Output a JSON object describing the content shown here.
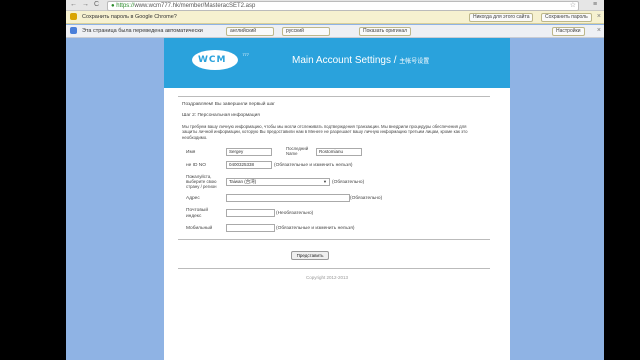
{
  "browser": {
    "url": {
      "scheme": "https://",
      "rest": "www.wcm777.hk/member/MasteracSET2.asp"
    },
    "nav_back": "←",
    "nav_forward": "→",
    "nav_reload": "C",
    "menu": "≡"
  },
  "password_bar": {
    "message": "Сохранить пароль в Google Chrome?",
    "save_label": "Сохранить пароль",
    "never_label": "Никогда для этого сайта"
  },
  "translate_bar": {
    "message": "Эта страница была переведена автоматически",
    "from_lang": "английский",
    "to_lang": "русский",
    "show_original_label": "Показать оригинал",
    "settings_label": "Настройки"
  },
  "site": {
    "logo_text": "WCM",
    "logo_tm": "777",
    "title": "Main Account Settings",
    "title_cn": "主帐号设置"
  },
  "intro": {
    "congrats": "Поздравляем! Вы завершили первый шаг",
    "step": "Шаг 2: Персональная информация",
    "para": "Мы требуем вашу личную информацию, чтобы мы могли отслеживать подтверждения транзакции. Мы внедрили процедуры обеспечения для защиты личной информации, которую Вы предоставили нам в Менеге не разрешает вашу личную информацию третьим лицам, кроме как это необходимо."
  },
  "form": {
    "first_name_label": "Имя",
    "first_name_value": "Sergey",
    "last_name_label": "Последний Name",
    "last_name_value": "Rostomianu",
    "id_label": "не ID NO",
    "id_value": "0400325338",
    "id_note": "(Обязательные и изменить нельзя)",
    "country_label": "Пожалуйста, выберите свою страну / регион",
    "country_value": "Taiwan (台湾)",
    "country_note": "(Обязательно)",
    "address_label": "Адрес",
    "address_value": "",
    "address_note": "(Обязательно)",
    "postal_label": "Почтовый индекс",
    "postal_value": "",
    "postal_note": "(Необязательно)",
    "mobile_label": "Мобильный",
    "mobile_value": "",
    "mobile_note": "(Обязательные и изменить нельзя)",
    "submit_label": "Представить"
  },
  "footer": {
    "copyright": "Copyright 2012-2013"
  },
  "colors": {
    "header": "#2aa2dc",
    "background": "#8fb3e4"
  }
}
